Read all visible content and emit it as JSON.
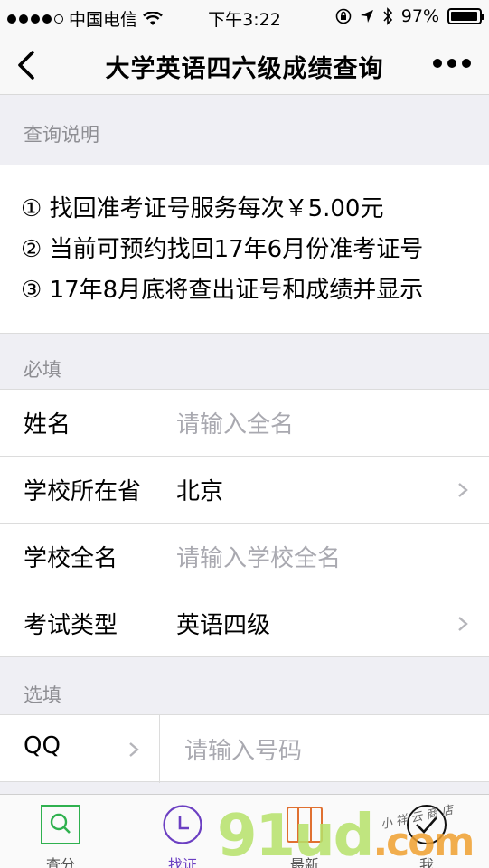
{
  "status": {
    "carrier": "中国电信",
    "time": "下午3:22",
    "battery": "97%",
    "battery_level": 0.97
  },
  "nav": {
    "title": "大学英语四六级成绩查询"
  },
  "notes_section": {
    "title": "查询说明",
    "items": [
      "① 找回准考证号服务每次￥5.00元",
      "② 当前可预约找回17年6月份准考证号",
      "③ 17年8月底将查出证号和成绩并显示"
    ]
  },
  "required": {
    "title": "必填",
    "name": {
      "label": "姓名",
      "placeholder": "请输入全名"
    },
    "province": {
      "label": "学校所在省",
      "value": "北京"
    },
    "school": {
      "label": "学校全名",
      "placeholder": "请输入学校全名"
    },
    "exam_type": {
      "label": "考试类型",
      "value": "英语四级"
    }
  },
  "optional": {
    "title": "选填",
    "qq": {
      "label": "QQ",
      "placeholder": "请输入号码"
    }
  },
  "tabs": [
    {
      "label": "查分",
      "icon": "search-icon"
    },
    {
      "label": "找证",
      "icon": "clock-icon"
    },
    {
      "label": "最新",
      "icon": "grid-icon"
    },
    {
      "label": "我",
      "icon": "check-icon"
    }
  ],
  "watermark": {
    "main": "91ud",
    "suffix": ".com",
    "small": "小 祥 云 商 店"
  },
  "colors": {
    "accent_green": "#2fb14f",
    "accent_purple": "#6b3fc2",
    "bg": "#efeff4"
  }
}
